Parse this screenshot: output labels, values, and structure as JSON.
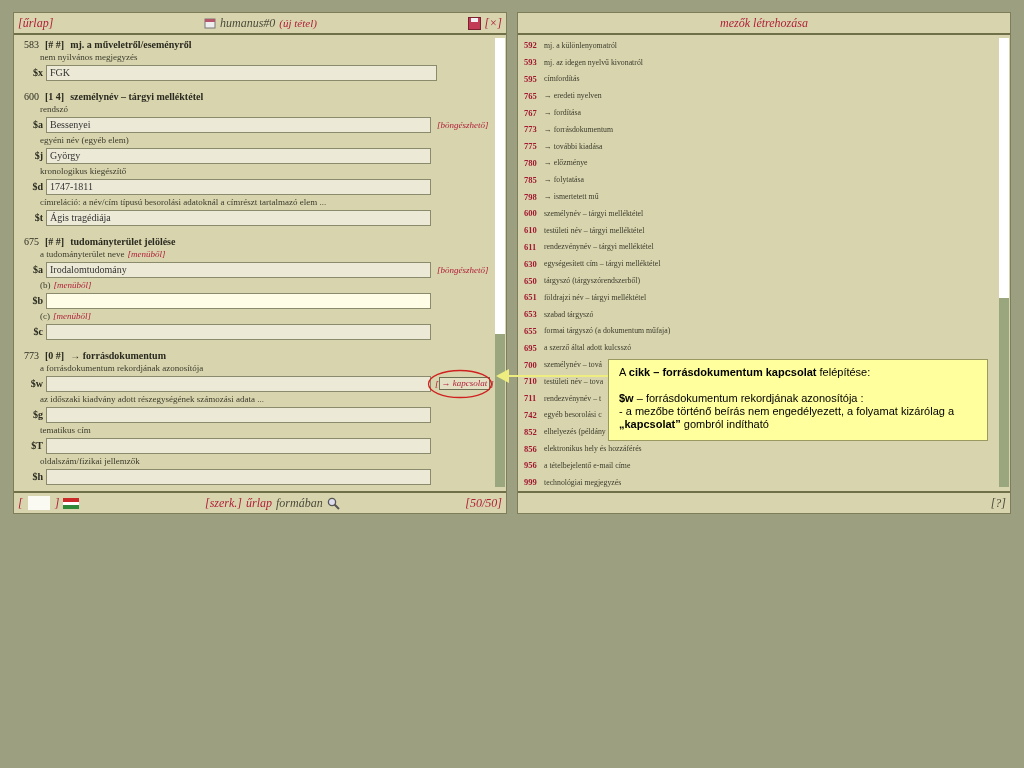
{
  "form_panel": {
    "header": {
      "menu": "[űrlap]",
      "record": "humanus#0",
      "status": "(új tétel)",
      "close": "[×]"
    },
    "fields": [
      {
        "tag": "583",
        "indicators": "[# #]",
        "title": "mj. a műveletről/eseményről",
        "subfields": [
          {
            "hint": "nem nyilvános megjegyzés",
            "code": "$x",
            "value": "FGK",
            "wide": true
          }
        ]
      },
      {
        "tag": "600",
        "indicators": "[1 4]",
        "title": "személynév – tárgyi melléktétel",
        "subfields": [
          {
            "hint": "rendszó",
            "code": "$a",
            "value": "Bessenyei",
            "link": "[böngészhető]"
          },
          {
            "hint": "egyéni név (egyéb elem)",
            "code": "$j",
            "value": "György"
          },
          {
            "hint": "kronologikus kiegészítő",
            "code": "$d",
            "value": "1747-1811"
          },
          {
            "hint": "címreláció: a név/cím típusú besorolási adatoknál a címrészt tartalmazó elem ...",
            "code": "$t",
            "value": "Ágis tragédiája"
          }
        ]
      },
      {
        "tag": "675",
        "indicators": "[# #]",
        "title": "tudományterület jelölése",
        "subfields": [
          {
            "hint": "a tudományterület neve",
            "hint_link": "[menüből]",
            "code": "$a",
            "value": "Irodalomtudomány",
            "link": "[böngészhető]"
          },
          {
            "hint": "(b)",
            "hint_link": "[menüből]",
            "code": "$b",
            "focused": true
          },
          {
            "hint": "(c)",
            "hint_link": "[menüből]",
            "code": "$c"
          }
        ]
      },
      {
        "tag": "773",
        "indicators": "[0 #]",
        "title": "→ forrásdokumentum",
        "subfields": [
          {
            "hint": "a forrásdokumentum rekordjának azonosítója",
            "code": "$w",
            "button": {
              "open": "[",
              "label": "→ kapcsolat",
              "close": "]",
              "highlighted": true
            }
          },
          {
            "hint": "az időszaki kiadvány adott részegységének számozási adata ...",
            "code": "$g"
          },
          {
            "hint": "tematikus cím",
            "code": "$T"
          },
          {
            "hint": "oldalszám/fizikai jellemzők",
            "code": "$h"
          }
        ]
      }
    ],
    "footer": {
      "open": "[",
      "close": "]",
      "edit": "[szerk.]",
      "mode": "űrlap",
      "mode_suffix": "formában",
      "counter": "[50/50]"
    }
  },
  "field_panel": {
    "title": "mezők létrehozása",
    "items": [
      {
        "code": "592",
        "label": "mj. a különlenyomatról"
      },
      {
        "code": "593",
        "label": "mj. az idegen nyelvű kivonatról"
      },
      {
        "code": "595",
        "label": "címfordítás"
      },
      {
        "code": "765",
        "label": "→ eredeti nyelven"
      },
      {
        "code": "767",
        "label": "→ fordítása"
      },
      {
        "code": "773",
        "label": "→ forrásdokumentum"
      },
      {
        "code": "775",
        "label": "→ további kiadása"
      },
      {
        "code": "780",
        "label": "→ előzménye"
      },
      {
        "code": "785",
        "label": "→ folytatása"
      },
      {
        "code": "798",
        "label": "→ ismertetett mű"
      },
      {
        "code": "600",
        "label": "személynév – tárgyi melléktétel"
      },
      {
        "code": "610",
        "label": "testületi név – tárgyi melléktétel"
      },
      {
        "code": "611",
        "label": "rendezvénynév – tárgyi melléktétel"
      },
      {
        "code": "630",
        "label": "egységesített cím – tárgyi melléktétel"
      },
      {
        "code": "650",
        "label": "tárgyszó (tárgyszórendszerből)"
      },
      {
        "code": "651",
        "label": "földrajzi név – tárgyi melléktétel"
      },
      {
        "code": "653",
        "label": "szabad tárgyszó"
      },
      {
        "code": "655",
        "label": "formai tárgyszó (a dokumentum műfaja)"
      },
      {
        "code": "695",
        "label": "a szerző által adott kulcsszó"
      },
      {
        "code": "700",
        "label": "személynév – tová"
      },
      {
        "code": "710",
        "label": "testületi név – tova"
      },
      {
        "code": "711",
        "label": "rendezvénynév – t"
      },
      {
        "code": "742",
        "label": "egyéb besorolási c"
      },
      {
        "code": "852",
        "label": "elhelyezés (példány"
      },
      {
        "code": "856",
        "label": "elektronikus hely és hozzáférés"
      },
      {
        "code": "956",
        "label": "a tételbejelentő e-mail címe"
      },
      {
        "code": "999",
        "label": "technológiai megjegyzés"
      }
    ],
    "help": "[?]"
  },
  "callout": {
    "heading": "A **cikk – forrásdokumentum kapcsolat** felépítése:",
    "lines": [
      "**$w** – forrásdokumentum rekordjának azonosítója :",
      "- a mezőbe történő beírás nem engedélyezett, a folyamat kizárólag a **„kapcsolat”**  gombról indítható"
    ]
  }
}
